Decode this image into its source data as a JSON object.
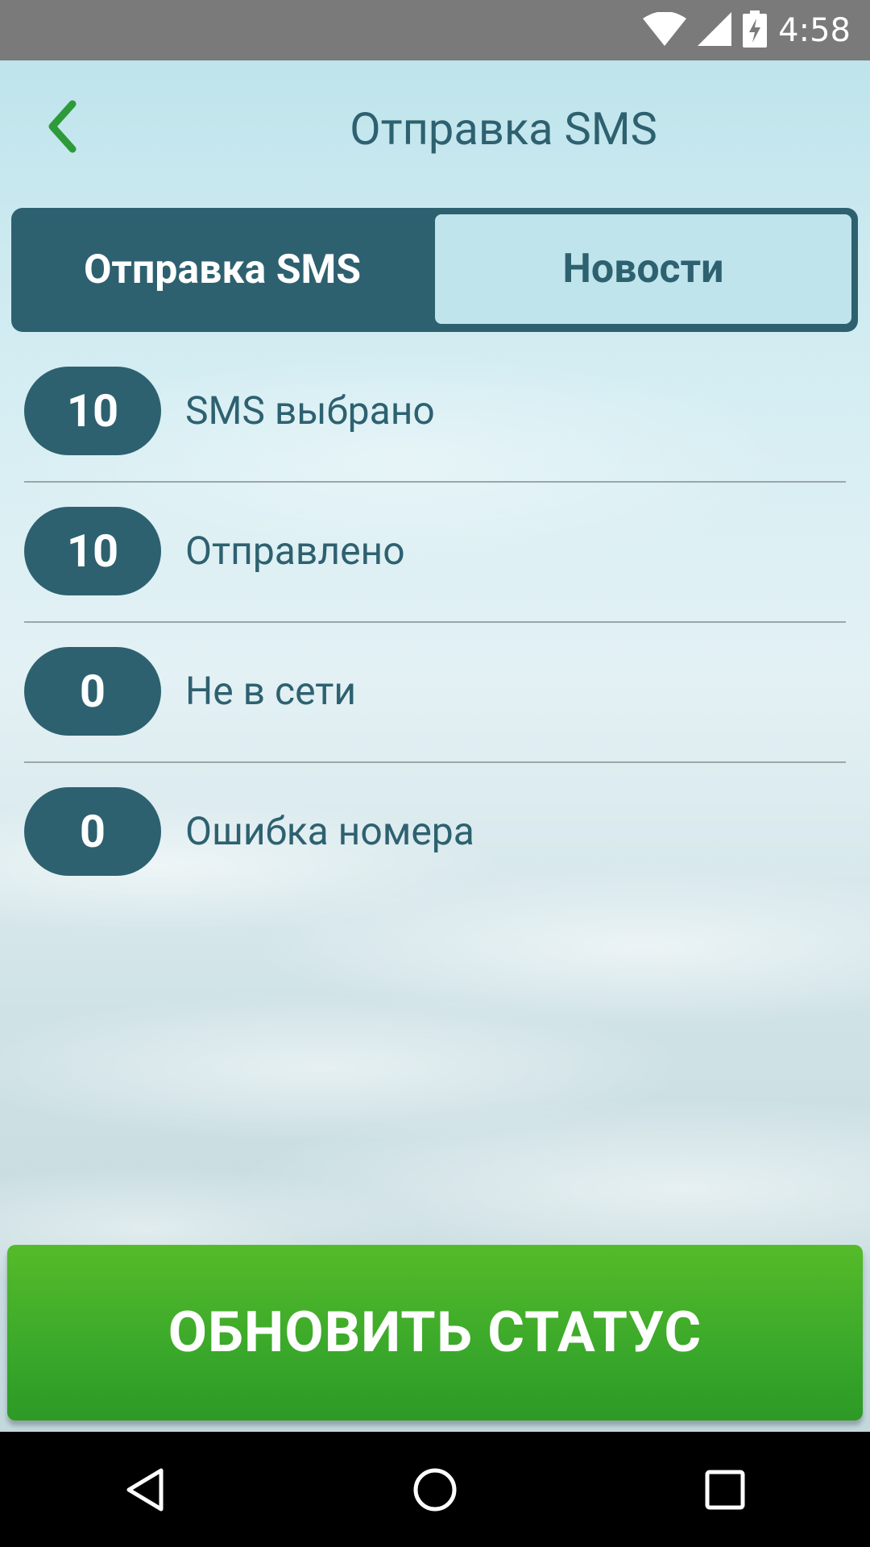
{
  "status_bar": {
    "time": "4:58",
    "icons": [
      "wifi-icon",
      "signal-icon",
      "battery-charging-icon"
    ]
  },
  "header": {
    "back_icon": "chevron-left-icon",
    "title": "Отправка SMS"
  },
  "tabs": [
    {
      "label": "Отправка SMS",
      "active": true
    },
    {
      "label": "Новости",
      "active": false
    }
  ],
  "stats": [
    {
      "count": "10",
      "label": "SMS выбрано"
    },
    {
      "count": "10",
      "label": "Отправлено"
    },
    {
      "count": "0",
      "label": "Не в сети"
    },
    {
      "count": "0",
      "label": "Ошибка номера"
    }
  ],
  "update_button": {
    "label": "ОБНОВИТЬ СТАТУС"
  },
  "nav_bar": {
    "icons": [
      "back-triangle-icon",
      "home-circle-icon",
      "recents-square-icon"
    ]
  },
  "colors": {
    "primary": "#2e6170",
    "accent_green": "#3aa82a",
    "back_arrow": "#2e9a3a",
    "tab_inactive_bg": "#bfe4ec"
  }
}
